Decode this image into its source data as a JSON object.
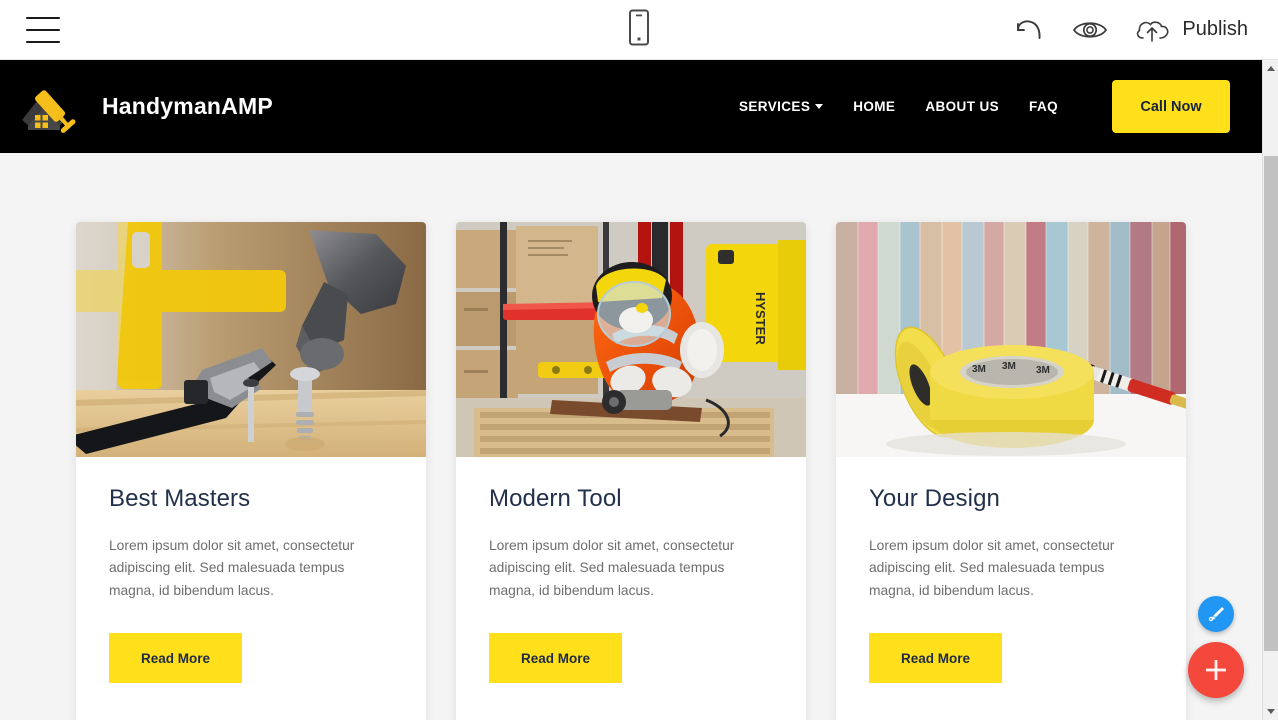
{
  "editor": {
    "menu_icon": "hamburger-menu-icon",
    "device_icon": "mobile-device-icon",
    "undo_icon": "undo-arrow-icon",
    "preview_icon": "eye-preview-icon",
    "publish_icon": "cloud-upload-icon",
    "publish_label": "Publish"
  },
  "site": {
    "brand": {
      "name": "HandymanAMP",
      "logo_icon": "house-paint-roller-logo"
    },
    "nav": [
      {
        "label": "SERVICES",
        "has_dropdown": true
      },
      {
        "label": "HOME",
        "has_dropdown": false
      },
      {
        "label": "ABOUT US",
        "has_dropdown": false
      },
      {
        "label": "FAQ",
        "has_dropdown": false
      }
    ],
    "cta": {
      "label": "Call Now"
    }
  },
  "cards": [
    {
      "title": "Best Masters",
      "text": "Lorem ipsum dolor sit amet, consectetur adipiscing elit. Sed malesuada tempus magna, id bibendum lacus.",
      "button": "Read More",
      "image_alt": "wrench-hammer-screws-on-wood"
    },
    {
      "title": "Modern Tool",
      "text": "Lorem ipsum dolor sit amet, consectetur adipiscing elit. Sed malesuada tempus magna, id bibendum lacus.",
      "button": "Read More",
      "image_alt": "worker-in-orange-suit-with-forklift"
    },
    {
      "title": "Your Design",
      "text": "Lorem ipsum dolor sit amet, consectetur adipiscing elit. Sed malesuada tempus magna, id bibendum lacus.",
      "button": "Read More",
      "image_alt": "yellow-masking-tape-and-brush"
    }
  ],
  "fabs": {
    "brush": {
      "icon": "paint-brush-icon"
    },
    "add": {
      "icon": "plus-icon"
    }
  },
  "scrollbar": {
    "up_icon": "scroll-up-arrow-icon",
    "down_icon": "scroll-down-arrow-icon"
  },
  "colors": {
    "accent_yellow": "#FFE01B",
    "nav_black": "#000000",
    "title_navy": "#22304a",
    "body_gray": "#6e6e6e",
    "canvas_bg": "#f4f4f4",
    "fab_blue": "#2196F3",
    "fab_red": "#F4483C"
  }
}
